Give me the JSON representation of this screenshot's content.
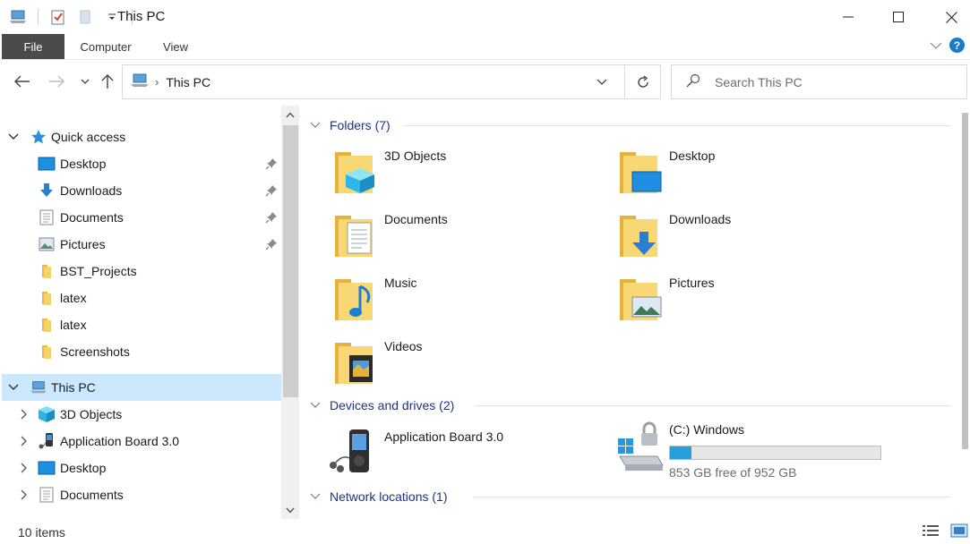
{
  "window": {
    "title": "This PC",
    "controls": {
      "minimize": "minimize-icon",
      "maximize": "maximize-icon",
      "close": "close-icon"
    }
  },
  "quick_access_toolbar": {
    "icons": [
      "pc-icon",
      "properties-icon",
      "new-folder-icon",
      "dropdown-icon"
    ]
  },
  "ribbon": {
    "tabs": [
      {
        "label": "File"
      },
      {
        "label": "Computer"
      },
      {
        "label": "View"
      }
    ]
  },
  "address": {
    "crumb": "This PC",
    "search_placeholder": "Search This PC"
  },
  "nav": {
    "items": [
      {
        "label": "Quick access",
        "icon": "star-icon",
        "expander": "expanded",
        "pinned": false
      },
      {
        "label": "Desktop",
        "icon": "desktop-icon",
        "pinned": true
      },
      {
        "label": "Downloads",
        "icon": "download-icon",
        "pinned": true
      },
      {
        "label": "Documents",
        "icon": "document-icon",
        "pinned": true
      },
      {
        "label": "Pictures",
        "icon": "picture-icon",
        "pinned": true
      },
      {
        "label": "BST_Projects",
        "icon": "folder-icon",
        "pinned": false
      },
      {
        "label": "latex",
        "icon": "folder-icon",
        "pinned": false
      },
      {
        "label": "latex",
        "icon": "folder-icon",
        "pinned": false
      },
      {
        "label": "Screenshots",
        "icon": "folder-icon",
        "pinned": false
      },
      {
        "label": "This PC",
        "icon": "pc-icon",
        "expander": "expanded",
        "selected": true
      },
      {
        "label": "3D Objects",
        "icon": "cube-icon",
        "expander": "collapsed"
      },
      {
        "label": "Application Board 3.0",
        "icon": "media-player-icon",
        "expander": "collapsed"
      },
      {
        "label": "Desktop",
        "icon": "desktop-icon",
        "expander": "collapsed"
      },
      {
        "label": "Documents",
        "icon": "document-icon",
        "expander": "collapsed"
      }
    ]
  },
  "content": {
    "groups": [
      {
        "label": "Folders (7)"
      },
      {
        "label": "Devices and drives (2)"
      },
      {
        "label": "Network locations (1)"
      }
    ],
    "folders": [
      {
        "label": "3D Objects",
        "icon": "folder-3d-objects-icon"
      },
      {
        "label": "Desktop",
        "icon": "folder-desktop-icon"
      },
      {
        "label": "Documents",
        "icon": "folder-documents-icon"
      },
      {
        "label": "Downloads",
        "icon": "folder-downloads-icon"
      },
      {
        "label": "Music",
        "icon": "folder-music-icon"
      },
      {
        "label": "Pictures",
        "icon": "folder-pictures-icon"
      },
      {
        "label": "Videos",
        "icon": "folder-videos-icon"
      }
    ],
    "devices": [
      {
        "label": "Application Board 3.0",
        "icon": "media-player-icon"
      },
      {
        "label": "(C:) Windows",
        "icon": "windows-drive-icon",
        "free_text": "853 GB free of 952 GB",
        "used_fraction": 0.104,
        "bar_color": "#26a0da"
      }
    ]
  },
  "status": {
    "item_count": "10 items"
  },
  "colors": {
    "selected_bg": "#cce8ff",
    "group_header": "#1e3287",
    "file_tab": "#4b4b4b",
    "accent": "#1979ca"
  }
}
